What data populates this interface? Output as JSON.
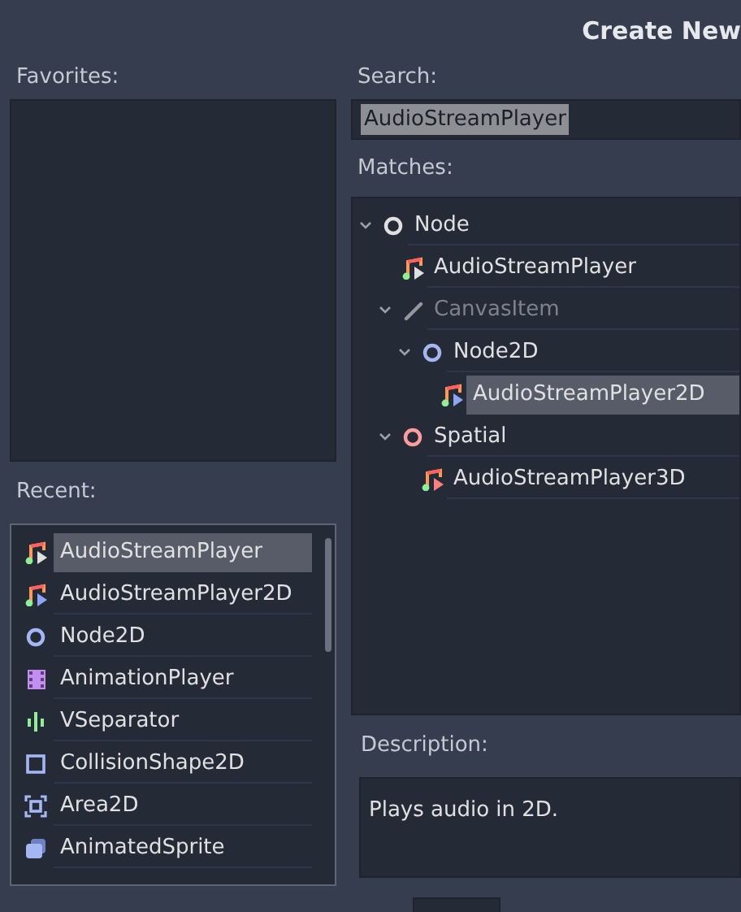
{
  "window": {
    "title": "Create New"
  },
  "favorites": {
    "label": "Favorites:"
  },
  "recent": {
    "label": "Recent:",
    "items": [
      {
        "kind": "audio",
        "label": "AudioStreamPlayer",
        "selected": true
      },
      {
        "kind": "audio2d",
        "label": "AudioStreamPlayer2D",
        "selected": false
      },
      {
        "kind": "node2d",
        "label": "Node2D",
        "selected": false
      },
      {
        "kind": "animation",
        "label": "AnimationPlayer",
        "selected": false
      },
      {
        "kind": "separator",
        "label": "VSeparator",
        "selected": false
      },
      {
        "kind": "shape",
        "label": "CollisionShape2D",
        "selected": false
      },
      {
        "kind": "area",
        "label": "Area2D",
        "selected": false
      },
      {
        "kind": "sprite",
        "label": "AnimatedSprite",
        "selected": false
      }
    ]
  },
  "search": {
    "label": "Search:",
    "value": "AudioStreamPlayer",
    "text_selected": true
  },
  "matches": {
    "label": "Matches:",
    "tree": [
      {
        "kind": "node",
        "label": "Node",
        "expanded": true,
        "disabled": false,
        "selected": false,
        "children": [
          {
            "kind": "audio",
            "label": "AudioStreamPlayer",
            "disabled": false,
            "selected": false
          },
          {
            "kind": "canvas",
            "label": "CanvasItem",
            "expanded": true,
            "disabled": true,
            "selected": false,
            "children": [
              {
                "kind": "node2d",
                "label": "Node2D",
                "expanded": true,
                "disabled": false,
                "selected": false,
                "children": [
                  {
                    "kind": "audio2d",
                    "label": "AudioStreamPlayer2D",
                    "disabled": false,
                    "selected": true
                  }
                ]
              }
            ]
          },
          {
            "kind": "spatial",
            "label": "Spatial",
            "expanded": true,
            "disabled": false,
            "selected": false,
            "children": [
              {
                "kind": "audio3d",
                "label": "AudioStreamPlayer3D",
                "disabled": false,
                "selected": false
              }
            ]
          }
        ]
      }
    ]
  },
  "description": {
    "label": "Description:",
    "text": "Plays audio in 2D."
  }
}
